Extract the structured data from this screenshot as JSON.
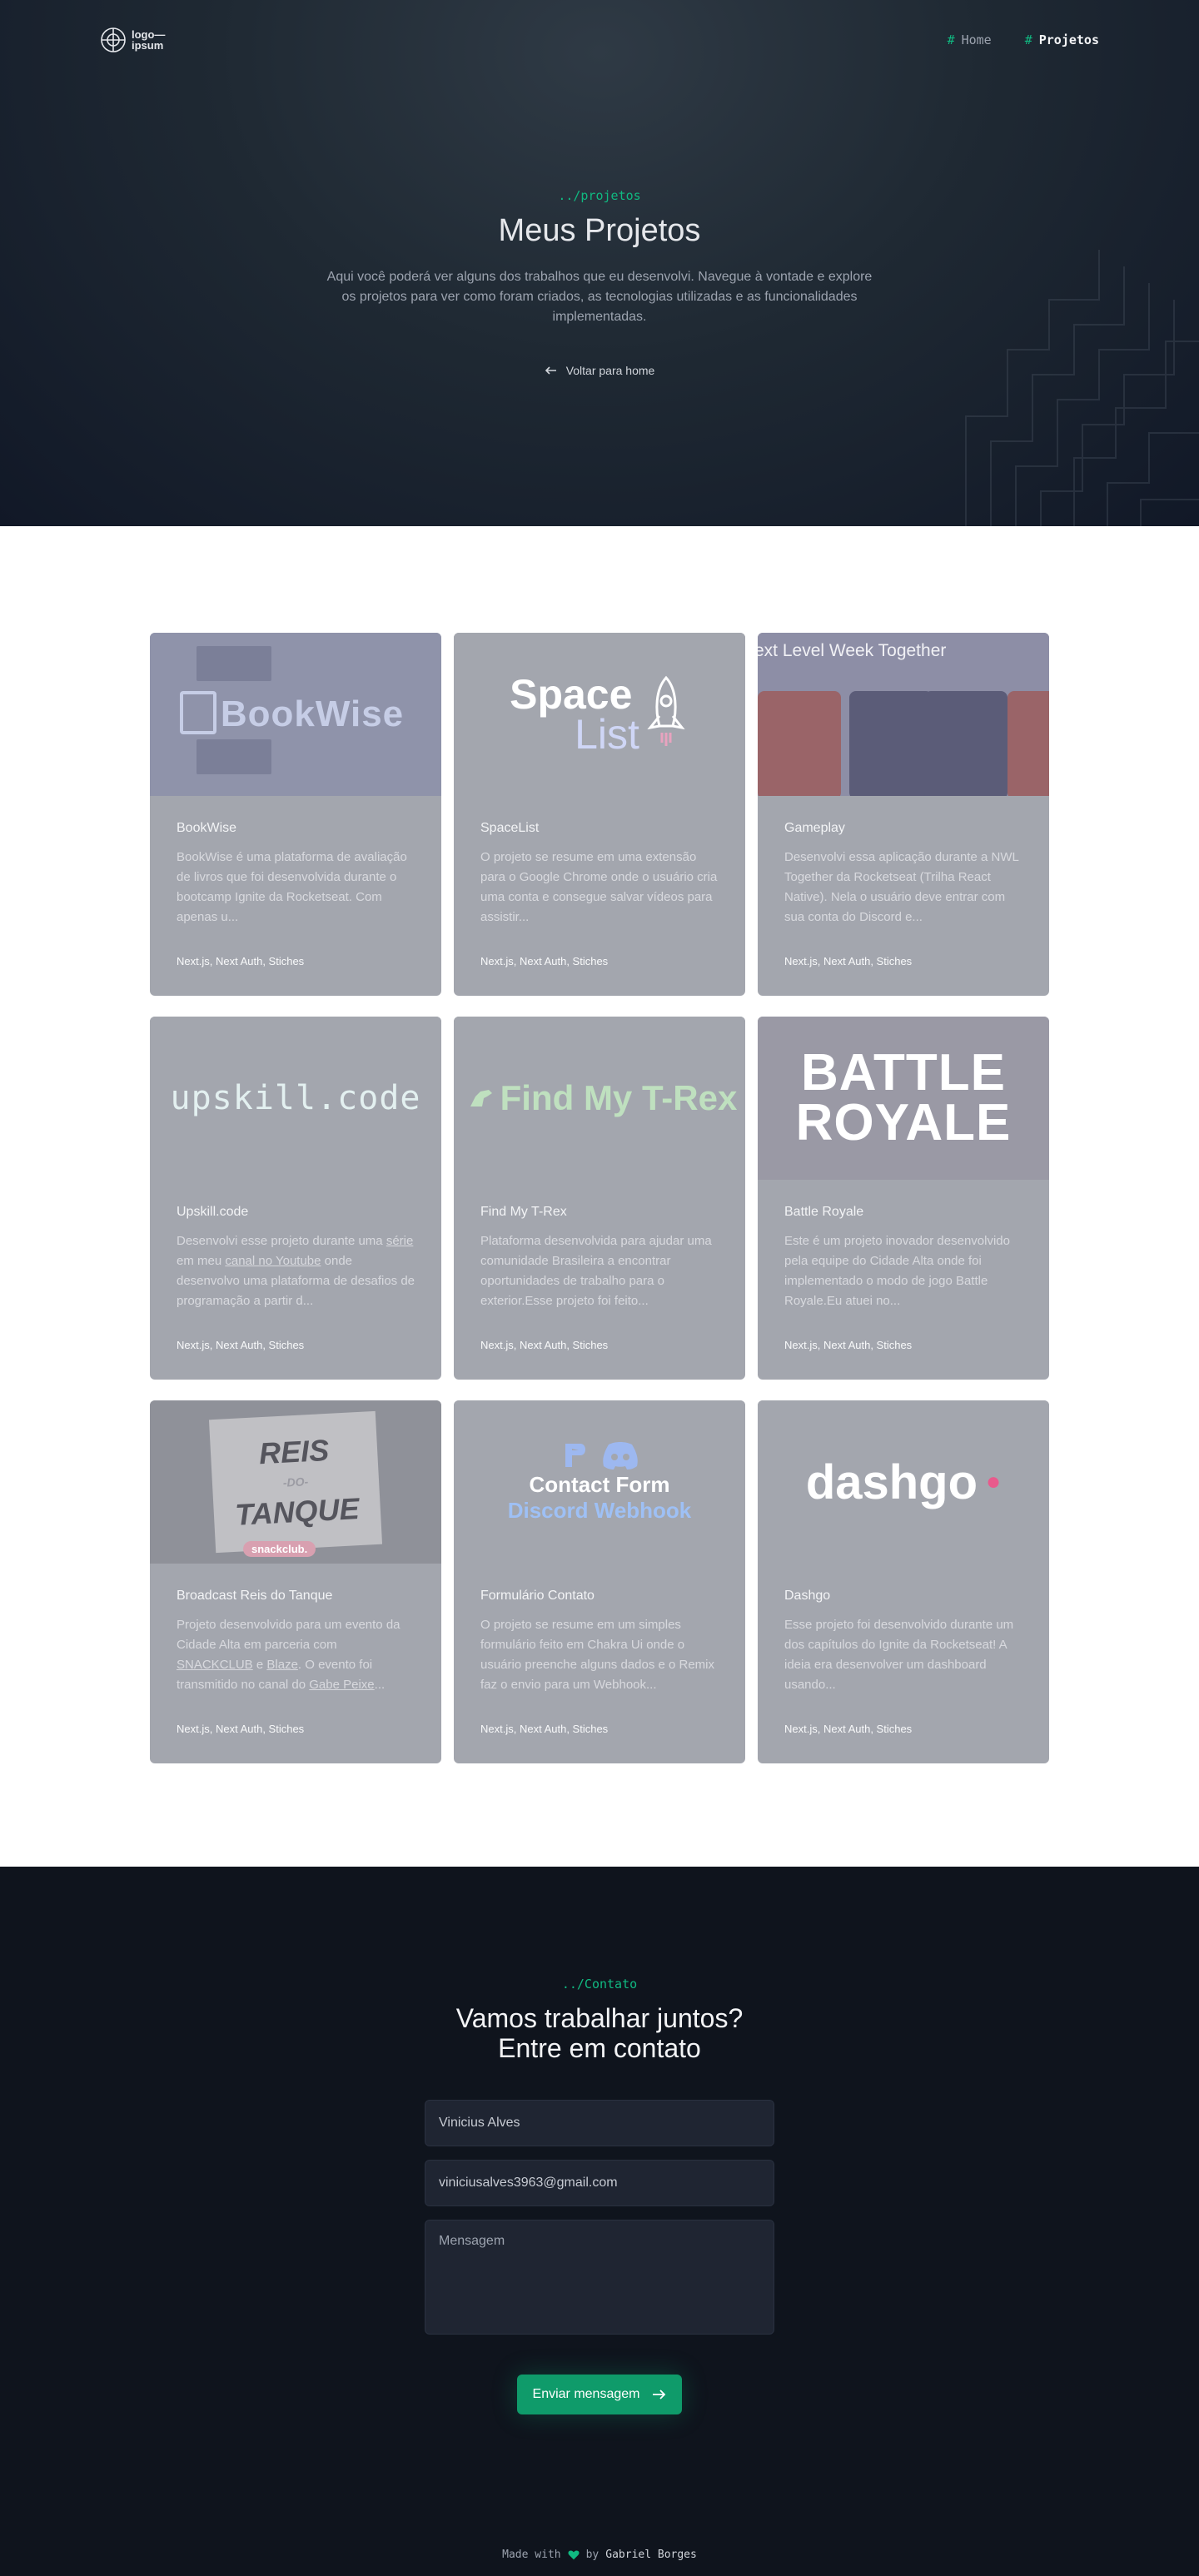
{
  "nav": {
    "logo": [
      "logo—",
      "ipsum"
    ],
    "links": [
      {
        "hash": "#",
        "label": "Home"
      },
      {
        "hash": "#",
        "label": "Projetos"
      }
    ]
  },
  "hero": {
    "breadcrumb": "../projetos",
    "title": "Meus Projetos",
    "description": "Aqui você poderá ver alguns dos trabalhos que eu desenvolvi. Navegue à vontade e explore os projetos para ver como foram criados, as tecnologias utilizadas e as funcionalidades implementadas.",
    "back_label": "Voltar para home"
  },
  "projects": [
    {
      "title": "BookWise",
      "desc": "BookWise é uma plataforma de avaliação de livros que foi desenvolvida durante o bootcamp Ignite da Rocketseat. Com apenas u...",
      "tags": "Next.js, Next Auth, Stiches",
      "thumb_text": "BookWise"
    },
    {
      "title": "SpaceList",
      "desc": "O projeto se resume em uma extensão para o Google Chrome onde o usuário cria uma conta e consegue salvar vídeos para assistir...",
      "tags": "Next.js, Next Auth, Stiches",
      "thumb_text": [
        "Space",
        "List"
      ]
    },
    {
      "title": "Gameplay",
      "desc": "Desenvolvi essa aplicação durante a NWL Together da Rocketseat (Trilha React Native). Nela o usuário deve entrar com sua conta do Discord e...",
      "tags": "Next.js, Next Auth, Stiches",
      "thumb_text": "ext Level Week Together"
    },
    {
      "title": "Upskill.code",
      "desc_parts": [
        "Desenvolvi esse projeto durante uma ",
        "série",
        " em meu ",
        "canal no Youtube",
        " onde desenvolvo uma plataforma de desafios de programação a partir d..."
      ],
      "tags": "Next.js, Next Auth, Stiches",
      "thumb_text": "upskill.code"
    },
    {
      "title": "Find My T-Rex",
      "desc": "Plataforma desenvolvida para ajudar uma comunidade Brasileira a encontrar oportunidades de trabalho para o exterior.Esse projeto foi feito...",
      "tags": "Next.js, Next Auth, Stiches",
      "thumb_text": "Find My T-Rex"
    },
    {
      "title": "Battle Royale",
      "desc": "Este é um projeto inovador desenvolvido pela equipe do Cidade Alta onde foi implementado o modo de jogo Battle Royale.Eu atuei no...",
      "tags": "Next.js, Next Auth, Stiches",
      "thumb_text": [
        "BATTLE",
        "ROYALE"
      ]
    },
    {
      "title": "Broadcast Reis do Tanque",
      "desc_parts": [
        "Projeto desenvolvido para um evento da Cidade Alta em parceria com ",
        "SNACKCLUB",
        " e ",
        "Blaze",
        ". O evento foi transmitido no canal do ",
        "Gabe Peixe",
        "..."
      ],
      "tags": "Next.js, Next Auth, Stiches",
      "thumb_text": [
        "REIS",
        "-DO-",
        "TANQUE",
        "snackclub."
      ]
    },
    {
      "title": "Formulário Contato",
      "desc": "O projeto se resume em um simples formulário feito em Chakra Ui onde o usuário preenche alguns dados e o Remix faz o envio para um Webhook...",
      "tags": "Next.js, Next Auth, Stiches",
      "thumb_text": [
        "Contact Form",
        "Discord Webhook"
      ]
    },
    {
      "title": "Dashgo",
      "desc": "Esse projeto foi desenvolvido durante um dos capítulos do Ignite da Rocketseat! A ideia era desenvolver um dashboard usando...",
      "tags": "Next.js, Next Auth, Stiches",
      "thumb_text": "dashgo"
    }
  ],
  "contact": {
    "breadcrumb": "../Contato",
    "title_line1": "Vamos trabalhar juntos?",
    "title_line2": "Entre em contato",
    "name_value": "Vinicius Alves",
    "email_value": "viniciusalves3963@gmail.com",
    "message_placeholder": "Mensagem",
    "send_label": "Enviar mensagem"
  },
  "footer": {
    "made_with": "Made with",
    "by": "by",
    "author": "Gabriel Borges"
  },
  "colors": {
    "accent": "#10b981",
    "hero_bg": "#1f2933",
    "card_bg": "#a3a6ae",
    "contact_bg": "#0f141d",
    "button_bg": "#0f9b6a"
  }
}
